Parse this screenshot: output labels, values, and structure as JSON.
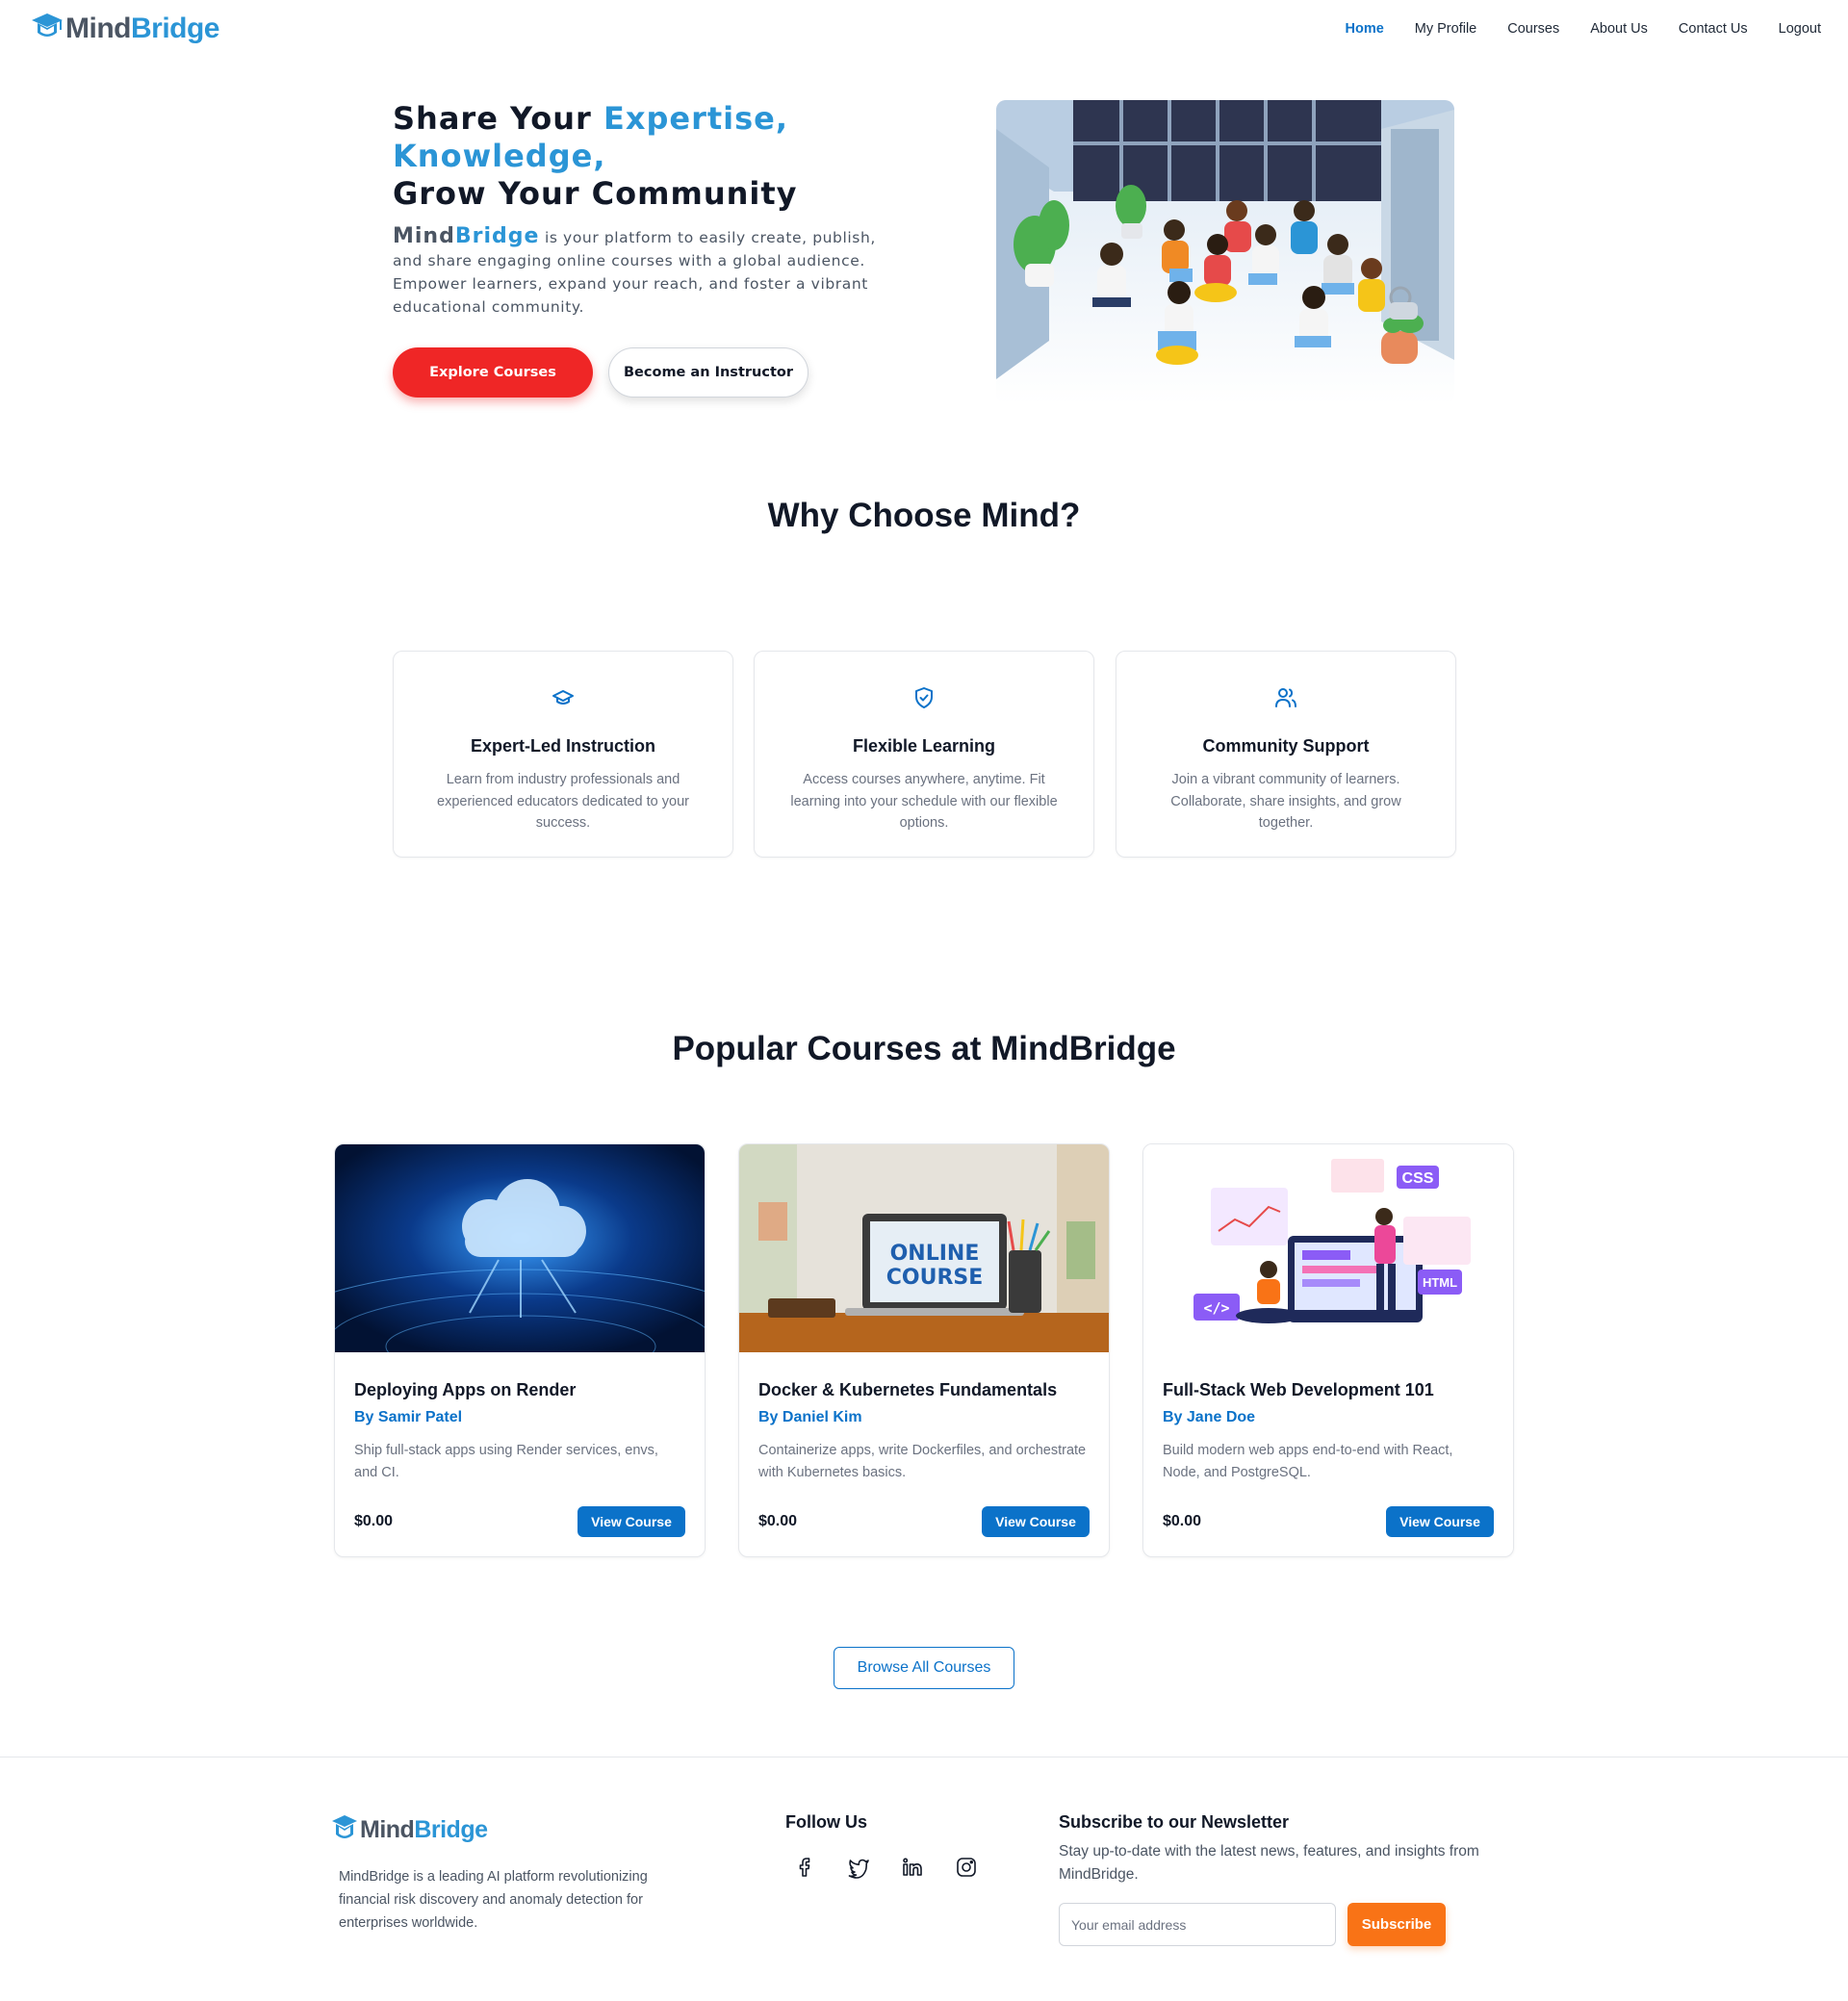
{
  "brand": {
    "mind": "Mind",
    "bridge": "Bridge"
  },
  "nav": {
    "home": "Home",
    "profile": "My Profile",
    "courses": "Courses",
    "about": "About Us",
    "contact": "Contact Us",
    "logout": "Logout"
  },
  "hero": {
    "title_part1": "Share Your ",
    "title_highlight1": "Expertise,",
    "title_highlight2": "Knowledge,",
    "title_part3": "Grow Your Community",
    "brand_mind": "Mind",
    "brand_bridge": "Bridge",
    "description": " is your platform to easily create, publish, and share engaging online courses with a global audience. Empower learners, expand your reach, and foster a vibrant educational community.",
    "explore_label": "Explore Courses",
    "instructor_label": "Become an Instructor"
  },
  "why": {
    "title": "Why Choose Mind?",
    "features": [
      {
        "title": "Expert-Led Instruction",
        "desc": "Learn from industry professionals and experienced educators dedicated to your success.",
        "icon": "graduation-cap-icon"
      },
      {
        "title": "Flexible Learning",
        "desc": "Access courses anywhere, anytime. Fit learning into your schedule with our flexible options.",
        "icon": "shield-check-icon"
      },
      {
        "title": "Community Support",
        "desc": "Join a vibrant community of learners. Collaborate, share insights, and grow together.",
        "icon": "users-icon"
      }
    ]
  },
  "popular": {
    "title": "Popular Courses at MindBridge",
    "courses": [
      {
        "title": "Deploying Apps on Render",
        "author": "By Samir Patel",
        "desc": "Ship full-stack apps using Render services, envs, and CI.",
        "price": "$0.00",
        "button": "View Course"
      },
      {
        "title": "Docker & Kubernetes Fundamentals",
        "author": "By Daniel Kim",
        "desc": "Containerize apps, write Dockerfiles, and orchestrate with Kubernetes basics.",
        "price": "$0.00",
        "button": "View Course",
        "image_text_1": "ONLINE",
        "image_text_2": "COURSE"
      },
      {
        "title": "Full-Stack Web Development 101",
        "author": "By Jane Doe",
        "desc": "Build modern web apps end-to-end with React, Node, and PostgreSQL.",
        "price": "$0.00",
        "button": "View Course",
        "image_text_css": "CSS",
        "image_text_html": "HTML"
      }
    ],
    "browse_label": "Browse All Courses"
  },
  "footer": {
    "about": "MindBridge is a leading AI platform revolutionizing financial risk discovery and anomaly detection for enterprises worldwide.",
    "follow_title": "Follow Us",
    "socials": [
      "facebook-icon",
      "twitter-icon",
      "linkedin-icon",
      "instagram-icon"
    ],
    "newsletter_title": "Subscribe to our Newsletter",
    "newsletter_desc": "Stay up-to-date with the latest news, features, and insights from MindBridge.",
    "email_placeholder": "Your email address",
    "subscribe_label": "Subscribe"
  },
  "colors": {
    "accent": "#2b95d6",
    "link": "#0b72c9",
    "explore": "#ef2626",
    "subscribe": "#f97316"
  }
}
